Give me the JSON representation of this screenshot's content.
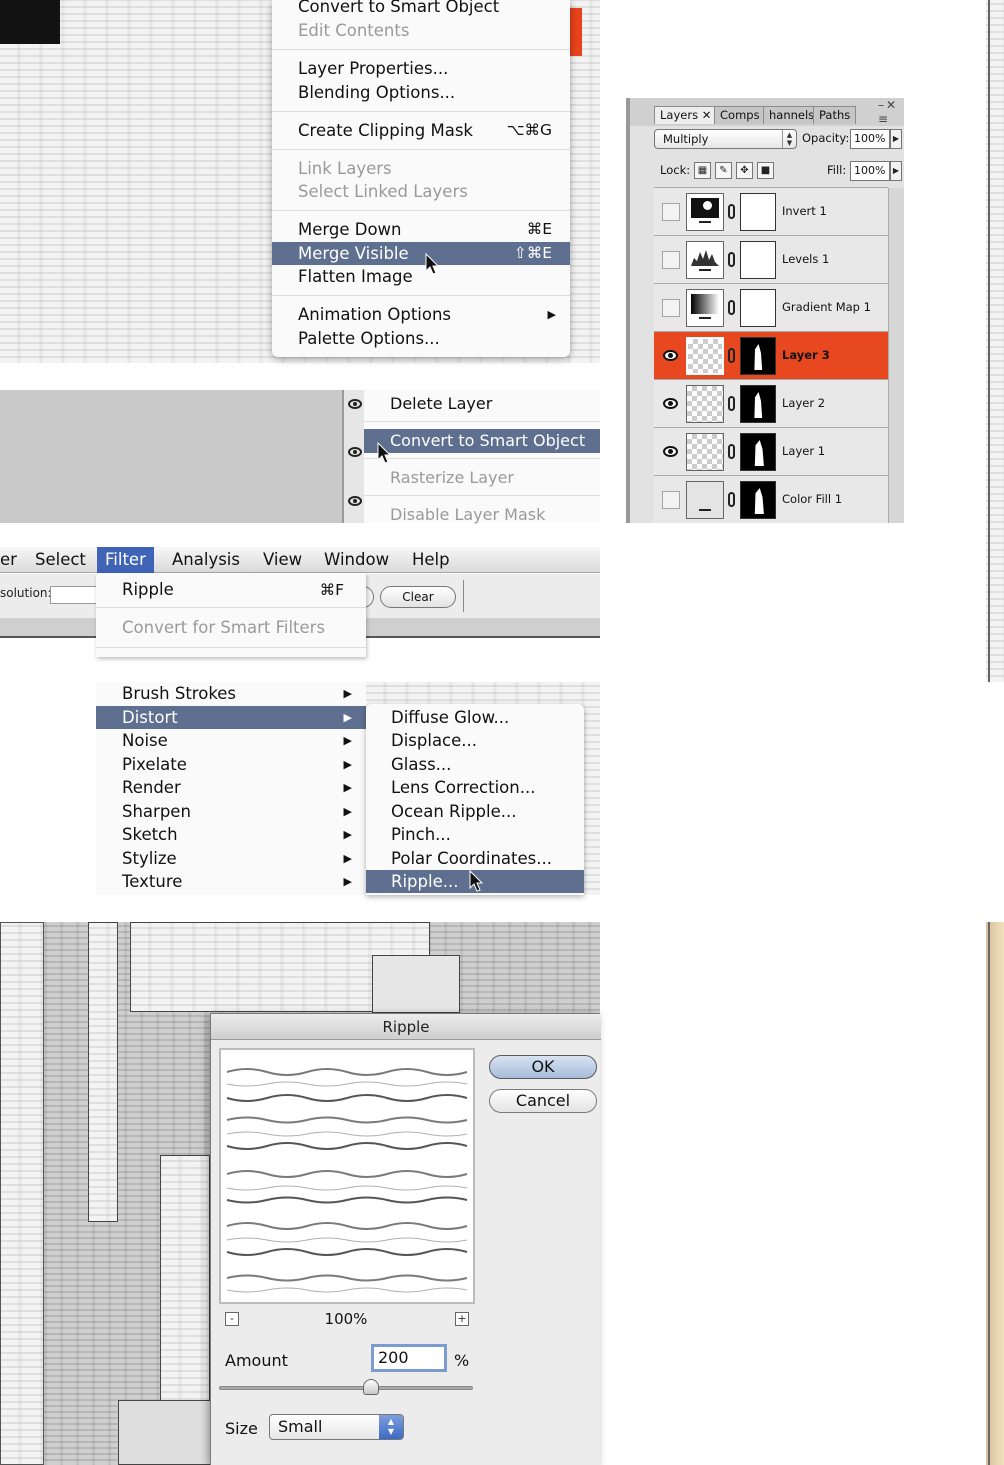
{
  "layer_menu": {
    "items": [
      {
        "label": "Convert to Smart Object",
        "state": "normal",
        "shortcut": ""
      },
      {
        "label": "Edit Contents",
        "state": "disabled",
        "shortcut": ""
      },
      {
        "label": "Layer Properties...",
        "state": "normal",
        "shortcut": ""
      },
      {
        "label": "Blending Options...",
        "state": "normal",
        "shortcut": ""
      },
      {
        "label": "Create Clipping Mask",
        "state": "normal",
        "shortcut": "⌥⌘G"
      },
      {
        "label": "Link Layers",
        "state": "disabled",
        "shortcut": ""
      },
      {
        "label": "Select Linked Layers",
        "state": "disabled",
        "shortcut": ""
      },
      {
        "label": "Merge Down",
        "state": "normal",
        "shortcut": "⌘E"
      },
      {
        "label": "Merge Visible",
        "state": "highlighted",
        "shortcut": "⇧⌘E"
      },
      {
        "label": "Flatten Image",
        "state": "normal",
        "shortcut": ""
      },
      {
        "label": "Animation Options",
        "state": "normal",
        "shortcut": "",
        "submenu_arrow": "▶"
      },
      {
        "label": "Palette Options...",
        "state": "normal",
        "shortcut": ""
      }
    ]
  },
  "layer_palette_menu": {
    "items": [
      {
        "label": "Delete Layer",
        "state": "normal"
      },
      {
        "label": "Convert to Smart Object",
        "state": "highlighted"
      },
      {
        "label": "Rasterize Layer",
        "state": "disabled"
      },
      {
        "label": "Disable Layer Mask",
        "state": "disabled"
      }
    ]
  },
  "menubar": {
    "items": [
      "er",
      "Select",
      "Filter",
      "Analysis",
      "View",
      "Window",
      "Help"
    ],
    "active": "Filter"
  },
  "options_bar": {
    "resolution_label": "solution:",
    "clear_label": "Clear"
  },
  "filter_menu": {
    "items": [
      {
        "label": "Ripple",
        "shortcut": "⌘F",
        "state": "normal"
      },
      {
        "label": "Convert for Smart Filters",
        "shortcut": "",
        "state": "disabled"
      }
    ]
  },
  "filter_submenu": {
    "arrow": "▶",
    "items": [
      {
        "label": "Brush Strokes",
        "state": "normal"
      },
      {
        "label": "Distort",
        "state": "highlighted"
      },
      {
        "label": "Noise",
        "state": "normal"
      },
      {
        "label": "Pixelate",
        "state": "normal"
      },
      {
        "label": "Render",
        "state": "normal"
      },
      {
        "label": "Sharpen",
        "state": "normal"
      },
      {
        "label": "Sketch",
        "state": "normal"
      },
      {
        "label": "Stylize",
        "state": "normal"
      },
      {
        "label": "Texture",
        "state": "normal"
      }
    ]
  },
  "distort_submenu": {
    "items": [
      {
        "label": "Diffuse Glow...",
        "state": "normal"
      },
      {
        "label": "Displace...",
        "state": "normal"
      },
      {
        "label": "Glass...",
        "state": "normal"
      },
      {
        "label": "Lens Correction...",
        "state": "normal"
      },
      {
        "label": "Ocean Ripple...",
        "state": "normal"
      },
      {
        "label": "Pinch...",
        "state": "normal"
      },
      {
        "label": "Polar Coordinates...",
        "state": "normal"
      },
      {
        "label": "Ripple...",
        "state": "highlighted"
      }
    ]
  },
  "ripple_dialog": {
    "title": "Ripple",
    "ok_label": "OK",
    "cancel_label": "Cancel",
    "zoom_out": "-",
    "zoom_in": "+",
    "zoom_level": "100%",
    "amount_label": "Amount",
    "amount_value": "200",
    "amount_unit": "%",
    "size_label": "Size",
    "size_value": "Small",
    "slider_fraction": 0.6
  },
  "layers_panel": {
    "tabs": [
      {
        "label": "Layers",
        "active": true
      },
      {
        "label": "Comps",
        "active": false
      },
      {
        "label": "hannels",
        "active": false
      },
      {
        "label": "Paths",
        "active": false
      }
    ],
    "close_glyph": "✕",
    "blend_mode": "Multiply",
    "opacity_label": "Opacity:",
    "opacity_value": "100%",
    "lock_label": "Lock:",
    "fill_label": "Fill:",
    "fill_value": "100%",
    "layers": [
      {
        "name": "Invert 1",
        "visible": false,
        "selected": false,
        "thumb": "invert",
        "mask": "white"
      },
      {
        "name": "Levels 1",
        "visible": false,
        "selected": false,
        "thumb": "levels",
        "mask": "white"
      },
      {
        "name": "Gradient Map 1",
        "visible": false,
        "selected": false,
        "thumb": "gradient",
        "mask": "white"
      },
      {
        "name": "Layer 3",
        "visible": true,
        "selected": true,
        "thumb": "transparent",
        "mask": "black-shape"
      },
      {
        "name": "Layer 2",
        "visible": true,
        "selected": false,
        "thumb": "transparent",
        "mask": "black-shape"
      },
      {
        "name": "Layer 1",
        "visible": true,
        "selected": false,
        "thumb": "transparent",
        "mask": "black-shape"
      },
      {
        "name": "Color Fill 1",
        "visible": false,
        "selected": false,
        "thumb": "fill",
        "mask": "black-shape"
      }
    ]
  },
  "colors": {
    "menu_highlight": "#5e6f8f",
    "menubar_active": "#3f63b6",
    "selected_layer": "#e8481f"
  }
}
